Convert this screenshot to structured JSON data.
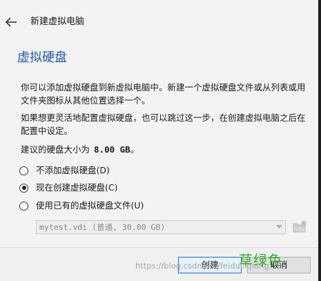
{
  "header": {
    "title": "新建虚拟电脑",
    "back_icon": "arrow-left-icon"
  },
  "main": {
    "section_title": "虚拟硬盘",
    "paragraph_1": "你可以添加虚拟硬盘到新虚拟电脑中。新建一个虚拟硬盘文件或从列表或用文件夹图标从其他位置选择一个。",
    "paragraph_2": "如果想更灵活地配置虚拟硬盘，也可以跳过这一步，在创建虚拟电脑之后在配置中设定。",
    "recommended_size_label": "建议的硬盘大小为",
    "recommended_size_value": "8.00 GB",
    "recommended_size_suffix": "。",
    "options": [
      {
        "label": "不添加虚拟硬盘(D)",
        "checked": false
      },
      {
        "label": "现在创建虚拟硬盘(C)",
        "checked": true
      },
      {
        "label": "使用已有的虚拟硬盘文件(U)",
        "checked": false
      }
    ],
    "existing_file": {
      "selected_value": "mytest.vdi (普通, 30.00 GB)",
      "enabled": false
    },
    "folder_icon": "folder-icon"
  },
  "footer": {
    "create_label": "创建",
    "cancel_label": "取消"
  },
  "watermark": {
    "url_text": "https://blog.csdn.net/feiduiliqiang",
    "cn_text": "草绿色"
  },
  "colors": {
    "title_blue": "#1e5aa8",
    "panel_bg": "#f3f3f3",
    "primary_border": "#1e6fd9",
    "watermark_green": "#2fae2f"
  }
}
